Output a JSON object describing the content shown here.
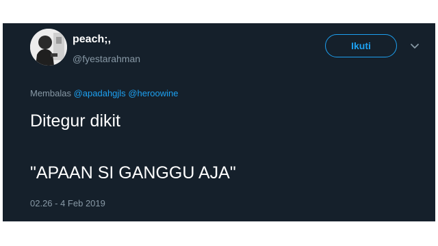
{
  "tweet": {
    "author": {
      "display_name": "peach;,",
      "handle": "@fyestarahman",
      "avatar_icon": "profile-photo-icon"
    },
    "follow_label": "Ikuti",
    "more_icon": "chevron-down-icon",
    "reply": {
      "prefix": "Membalas",
      "mentions": [
        "@apadahgjls",
        "@heroowine"
      ]
    },
    "text_lines": [
      "Ditegur dikit",
      "\"APAAN SI GANGGU AJA\""
    ],
    "timestamp": "02.26 - 4 Feb 2019"
  },
  "colors": {
    "background": "#15202b",
    "accent": "#1da1f2",
    "text_primary": "#ffffff",
    "text_secondary": "#8899a6"
  }
}
